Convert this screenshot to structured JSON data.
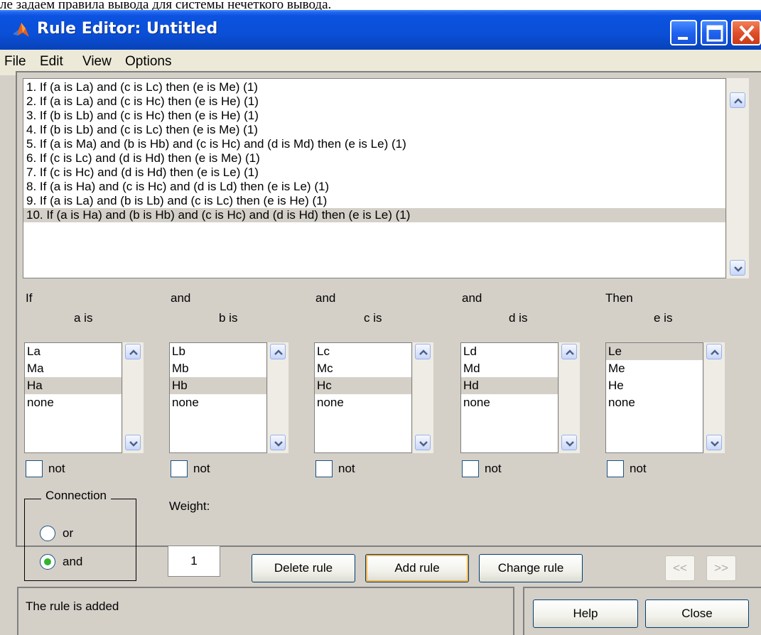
{
  "caption": "ле задаем правила вывода для системы нечеткого вывода.",
  "window": {
    "title": "Rule Editor: Untitled"
  },
  "menu": [
    "File",
    "Edit",
    "View",
    "Options"
  ],
  "rules": [
    "1. If (a is La) and (c is Lc) then (e is Me) (1)",
    "2. If (a is La) and (c is Hc) then (e is He) (1)",
    "3. If (b is Lb) and (c is Hc) then (e is He) (1)",
    "4. If (b is Lb) and (c is Lc) then (e is Me) (1)",
    "5. If (a is Ma) and (b is Hb) and (c is Hc) and (d is Md) then (e is Le) (1)",
    "6. If (c is Lc) and (d is Hd) then (e is Me) (1)",
    "7. If (c is Hc) and (d is Hd) then (e is Le) (1)",
    "8. If (a is Ha) and (c is Hc) and (d is Ld) then (e is Le) (1)",
    "9. If (a is La) and (b is Lb) and (c is Lc) then (e is He) (1)",
    "10. If (a is Ha) and (b is Hb) and (c is Hc) and (d is Hd) then (e is Le) (1)"
  ],
  "selected_rule": 9,
  "variables": [
    {
      "connector": "If",
      "label": "a is",
      "options": [
        "La",
        "Ma",
        "Ha",
        "none"
      ],
      "selected": 2,
      "not_label": "not",
      "not_checked": false
    },
    {
      "connector": "and",
      "label": "b is",
      "options": [
        "Lb",
        "Mb",
        "Hb",
        "none"
      ],
      "selected": 2,
      "not_label": "not",
      "not_checked": false
    },
    {
      "connector": "and",
      "label": "c is",
      "options": [
        "Lc",
        "Mc",
        "Hc",
        "none"
      ],
      "selected": 2,
      "not_label": "not",
      "not_checked": false
    },
    {
      "connector": "and",
      "label": "d is",
      "options": [
        "Ld",
        "Md",
        "Hd",
        "none"
      ],
      "selected": 2,
      "not_label": "not",
      "not_checked": false
    },
    {
      "connector": "Then",
      "label": "e is",
      "options": [
        "Le",
        "Me",
        "He",
        "none"
      ],
      "selected": 0,
      "not_label": "not",
      "not_checked": false
    }
  ],
  "connection": {
    "title": "Connection",
    "options": [
      "or",
      "and"
    ],
    "selected": "and"
  },
  "weight": {
    "label": "Weight:",
    "value": "1"
  },
  "buttons": {
    "delete": "Delete rule",
    "add": "Add rule",
    "change": "Change rule",
    "prev": "<<",
    "next": ">>",
    "help": "Help",
    "close": "Close"
  },
  "status": "The rule is added",
  "colors": {
    "titlebar": "#0a4fd6",
    "face": "#d4d0c8",
    "selection": "#d4d0c8",
    "radio_dot": "#2fb52f",
    "focus_ring": "#f6b44a"
  }
}
